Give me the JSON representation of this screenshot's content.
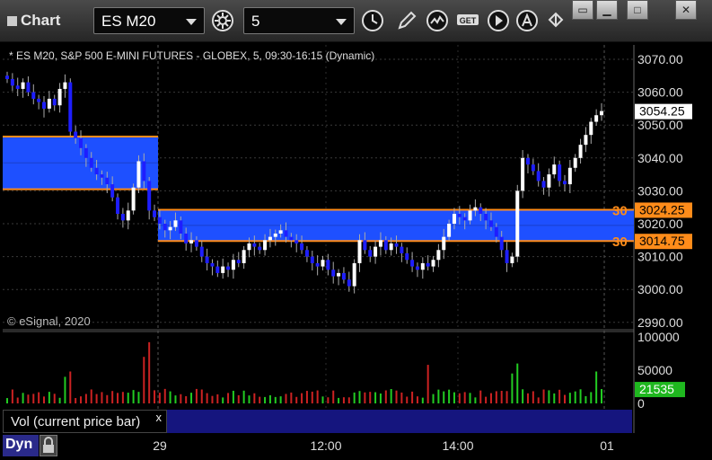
{
  "window": {
    "title": "Chart"
  },
  "toolbar": {
    "symbol": "ES M20",
    "interval": "5",
    "icons": [
      "gear-icon",
      "clock-icon",
      "pencil-icon",
      "wave-icon",
      "get-icon",
      "play-icon",
      "alert-icon",
      "cursor-icon"
    ]
  },
  "chart": {
    "header": "* ES M20, S&P 500 E-MINI FUTURES - GLOBEX, 5, 09:30-16:15 (Dynamic)",
    "copyright": "© eSignal, 2020",
    "price_axis": [
      "3070.00",
      "3060.00",
      "3050.00",
      "3040.00",
      "3030.00",
      "3020.00",
      "3010.00",
      "3000.00",
      "2990.00"
    ],
    "last_price": "3054.25",
    "zones": [
      {
        "tag": "30",
        "price": "3024.25"
      },
      {
        "tag": "30",
        "price": "3014.75"
      }
    ],
    "time_axis": [
      "29",
      "12:00",
      "14:00",
      "01"
    ],
    "volume_axis": [
      "100000",
      "50000",
      "0"
    ],
    "volume_last": "21535",
    "colors": {
      "up": "#ffffff",
      "down": "#1e1eff",
      "zone": "#1e50ff",
      "zone_border": "#ff8c1a",
      "vol_up": "#22cc22",
      "vol_down": "#cc2222"
    }
  },
  "study": {
    "label": "Vol (current price bar)",
    "close": "x"
  },
  "footer": {
    "mode": "Dyn"
  }
}
